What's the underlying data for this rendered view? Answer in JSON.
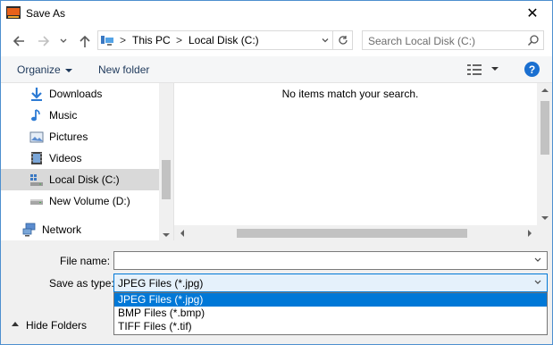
{
  "window": {
    "title": "Save As",
    "close_glyph": "✕"
  },
  "nav_buttons": {
    "back": "back-arrow-icon",
    "forward": "forward-arrow-icon",
    "recent": "chevron-down-icon",
    "up": "up-arrow-icon"
  },
  "address": {
    "icon": "this-pc-icon",
    "separator": ">",
    "crumbs": [
      "This PC",
      "Local Disk (C:)"
    ],
    "refresh_icon": "refresh-icon"
  },
  "search": {
    "placeholder": "Search Local Disk (C:)"
  },
  "toolbar": {
    "organize_label": "Organize",
    "new_folder_label": "New folder",
    "help_glyph": "?"
  },
  "sidebar": {
    "items": [
      {
        "label": "Downloads",
        "icon": "downloads-icon"
      },
      {
        "label": "Music",
        "icon": "music-icon"
      },
      {
        "label": "Pictures",
        "icon": "pictures-icon"
      },
      {
        "label": "Videos",
        "icon": "videos-icon"
      },
      {
        "label": "Local Disk (C:)",
        "icon": "local-disk-icon",
        "selected": true
      },
      {
        "label": "New Volume (D:)",
        "icon": "drive-icon"
      },
      {
        "label": "Network",
        "icon": "network-icon"
      }
    ]
  },
  "file_list": {
    "empty_message": "No items match your search."
  },
  "form": {
    "file_name_label": "File name:",
    "file_name_value": "",
    "save_as_type_label": "Save as type:",
    "save_as_type_value": "JPEG Files (*.jpg)",
    "type_options": [
      "JPEG Files (*.jpg)",
      "BMP Files (*.bmp)",
      "TIFF Files (*.tif)"
    ],
    "selected_type_index": 0
  },
  "footer": {
    "hide_folders_label": "Hide Folders"
  },
  "colors": {
    "accent": "#0078d7",
    "selection": "#d9d9d9",
    "link_text": "#1e395b"
  }
}
